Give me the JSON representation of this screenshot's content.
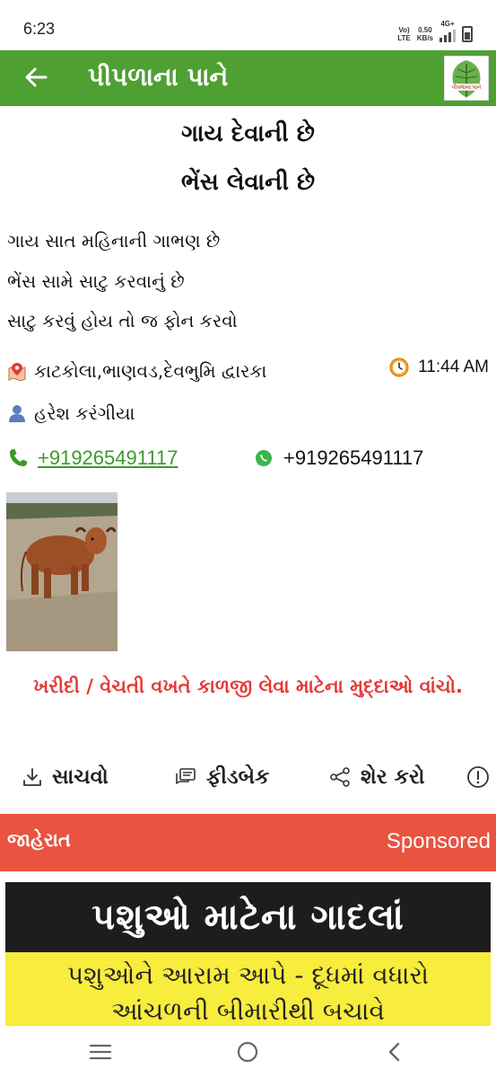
{
  "status_bar": {
    "time": "6:23",
    "volte": "Vo)\nLTE",
    "speed_value": "0.50",
    "speed_unit": "KB/s",
    "network": "4G+"
  },
  "app_bar": {
    "back_icon": "arrow-left-icon",
    "title": "પીપળાના પાને",
    "logo_text": "પીપળાના પાને",
    "color": "#4fa033"
  },
  "post": {
    "headline_1": "ગાય દેવાની છે",
    "headline_2": "ભેંસ લેવાની છે",
    "description": [
      "ગાય સાત મહિનાની ગાભણ છે",
      "ભેંસ સામે સાટુ કરવાનું છે",
      "સાટુ કરવું હોય તો જ ફોન કરવો"
    ],
    "location": "કાટકોલા,ભાણવડ,દેવભુમિ દ્વારકા",
    "time": "11:44 AM",
    "author": "હરેશ કરંગીયા",
    "phone": "+919265491117",
    "whatsapp": "+919265491117"
  },
  "tips_link": "ખરીદી / વેચતી વખતે કાળજી લેવા માટેના મુદ્દાઓ વાંચો.",
  "actions": {
    "save": "સાચવો",
    "feedback": "ફીડબેક",
    "share": "શેર કરો"
  },
  "ad": {
    "label": "જાહેરાત",
    "sponsored": "Sponsored",
    "banner_title": "પશુઓ માટેના ગાદલાં",
    "banner_line_1": "પશુઓને આરામ આપે - દૂધમાં વધારો",
    "banner_line_2": "આંચળની બીમારીથી બચાવે"
  },
  "colors": {
    "accent_green": "#4fa033",
    "link_green": "#3b9a2a",
    "alert_red": "#e53935",
    "ad_red": "#e95340",
    "ad_yellow": "#f8ec3c"
  }
}
